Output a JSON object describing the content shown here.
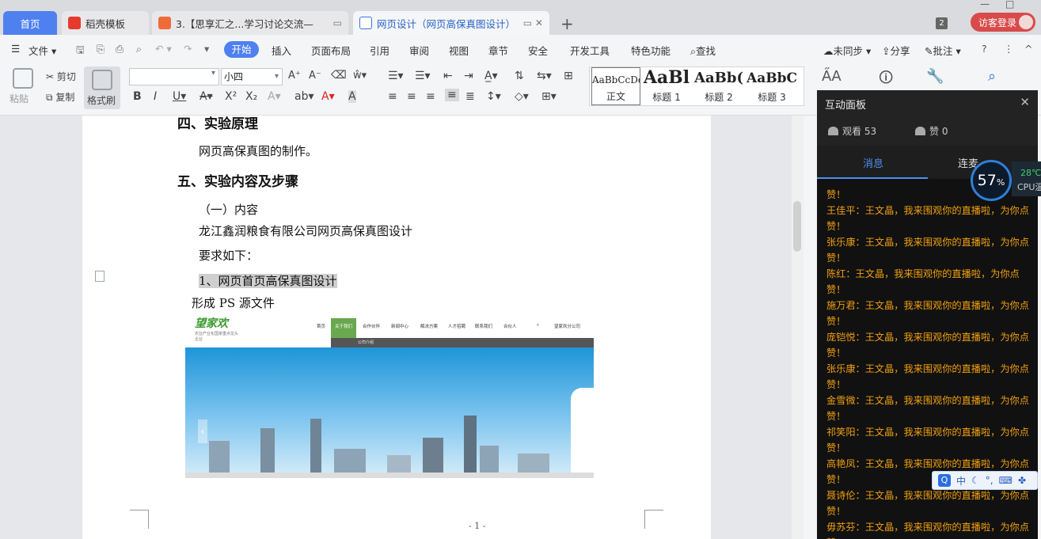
{
  "tabs": [
    {
      "label": "首页"
    },
    {
      "label": "稻壳模板"
    },
    {
      "label": "3.【思享汇之...学习讨论交流—"
    },
    {
      "label": "网页设计（网页高保真图设计）"
    }
  ],
  "tabbar": {
    "badge": "2",
    "login": "访客登录",
    "add": "+"
  },
  "menu": {
    "file": "文件",
    "items": [
      "开始",
      "插入",
      "页面布局",
      "引用",
      "审阅",
      "视图",
      "章节",
      "安全",
      "开发工具",
      "特色功能",
      "查找"
    ],
    "right": {
      "sync": "未同步",
      "share": "分享",
      "annotate": "批注"
    }
  },
  "ribbon": {
    "paste": "粘贴",
    "cut": "剪切",
    "copy": "复制",
    "format_brush": "格式刷",
    "font_size": "小四",
    "styles": [
      {
        "sample": "AaBbCcDd",
        "name": "正文"
      },
      {
        "sample": "AaBl",
        "name": "标题 1"
      },
      {
        "sample": "AaBb(",
        "name": "标题 2"
      },
      {
        "sample": "AaBbC",
        "name": "标题 3"
      }
    ]
  },
  "doc": {
    "heading4": "四、实验原理",
    "line1": "网页高保真图的制作。",
    "heading5": "五、实验内容及步骤",
    "line2": "（一）内容",
    "line3": "龙江鑫润粮食有限公司网页高保真图设计",
    "line4": "要求如下：",
    "line5": "1、网页首页高保真图设计",
    "line6": "形成 PS 源文件",
    "page_number": "- 1 -"
  },
  "site": {
    "logo": "望家欢",
    "logo_sub": "农业产业化国家重点龙头企业",
    "menu": [
      "首页",
      "关于我们",
      "合作伙伴",
      "新闻中心",
      "解决方案",
      "人才招聘",
      "联系我们",
      "合伙人"
    ],
    "submenu": "公司介绍",
    "branch": "望家欢分公司"
  },
  "panel": {
    "title": "互动面板",
    "views": "观看 53",
    "likes": "赞 0",
    "tabs": [
      "消息",
      "连麦"
    ],
    "messages": [
      "赞！",
      "王佳平：王文晶，我来围观你的直播啦，为你点赞！",
      "张乐康：王文晶，我来围观你的直播啦，为你点赞！",
      "陈红：王文晶，我来围观你的直播啦，为你点赞！",
      "施万君：王文晶，我来围观你的直播啦，为你点赞！",
      "庞铠悦：王文晶，我来围观你的直播啦，为你点赞！",
      "张乐康：王文晶，我来围观你的直播啦，为你点赞！",
      "金雪微：王文晶，我来围观你的直播啦，为你点赞！",
      "祁笑阳：王文晶，我来围观你的直播啦，为你点赞！",
      "高艳凤：王文晶，我来围观你的直播啦，为你点赞！",
      "聂诗伦：王文晶，我来围观你的直播啦，为你点赞！",
      "毋苏芬：王文晶，我来围观你的直播啦，为你点赞！"
    ]
  },
  "cpu": {
    "percent": "57",
    "unit": "%",
    "temp": "28℃",
    "label": "CPU温度"
  },
  "ime": {
    "lang": "中"
  },
  "colors": {
    "accent": "#4e80f0",
    "message": "#f0a010",
    "panel_bg": "#111111"
  }
}
